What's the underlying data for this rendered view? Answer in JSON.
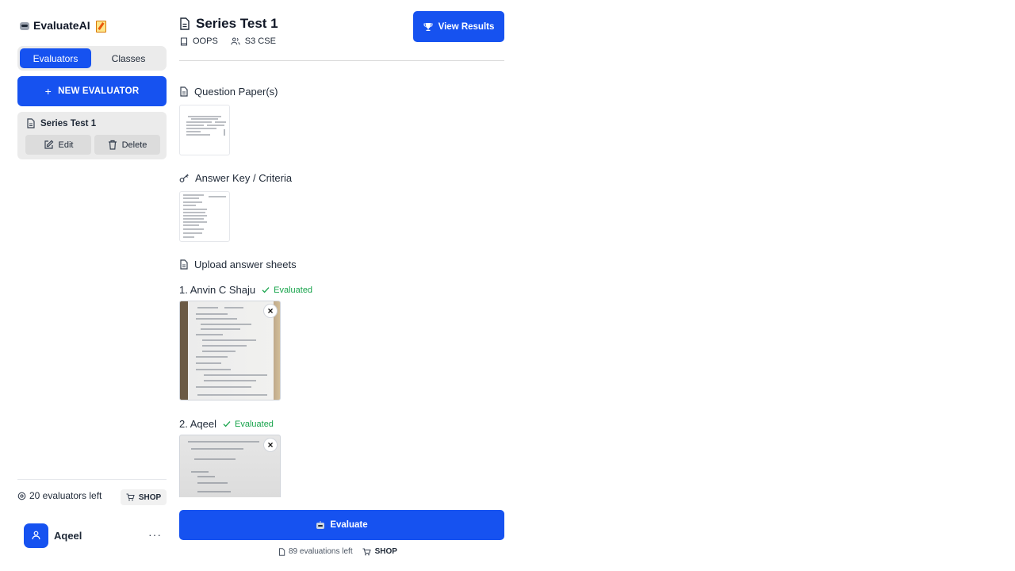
{
  "app": {
    "name": "EvaluateAI"
  },
  "sidebar": {
    "tabs": [
      {
        "label": "Evaluators",
        "active": true
      },
      {
        "label": "Classes",
        "active": false
      }
    ],
    "new_button_label": "NEW EVALUATOR",
    "evaluators": [
      {
        "title": "Series Test 1",
        "edit_label": "Edit",
        "delete_label": "Delete"
      }
    ],
    "evaluators_left": "20 evaluators left",
    "shop_label": "SHOP",
    "user": {
      "name": "Aqeel"
    }
  },
  "main": {
    "title": "Series Test 1",
    "subject": "OOPS",
    "class": "S3 CSE",
    "view_results_label": "View Results",
    "question_papers_heading": "Question Paper(s)",
    "answer_key_heading": "Answer Key / Criteria",
    "upload_heading": "Upload answer sheets",
    "students": [
      {
        "label": "1. Anvin C Shaju",
        "status": "Evaluated"
      },
      {
        "label": "2. Aqeel",
        "status": "Evaluated"
      }
    ],
    "evaluate_label": "Evaluate",
    "evaluations_left": "89 evaluations left",
    "shop_label": "SHOP"
  },
  "colors": {
    "primary": "#1652f0",
    "success": "#16a34a",
    "card": "#ebebeb"
  },
  "icons": [
    "robot-icon",
    "memo-icon",
    "plus-icon",
    "file-icon",
    "edit-icon",
    "trash-icon",
    "gear-icon",
    "cart-icon",
    "user-icon",
    "more-icon",
    "trophy-icon",
    "book-icon",
    "users-icon",
    "key-icon",
    "check-icon",
    "close-icon"
  ]
}
